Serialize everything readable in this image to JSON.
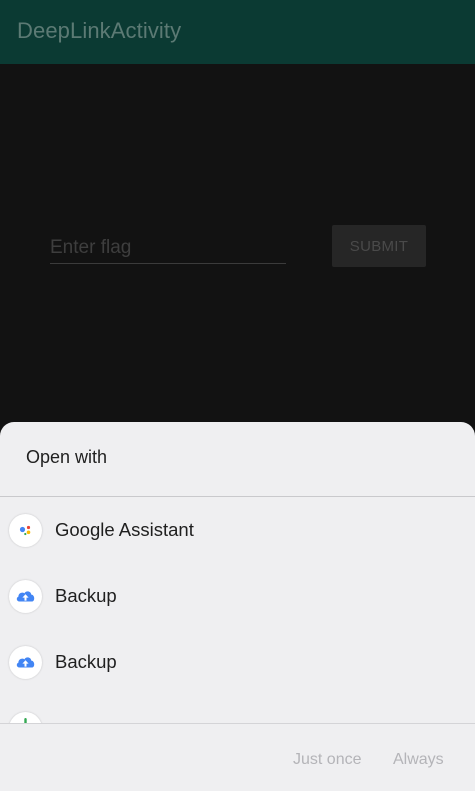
{
  "appbar": {
    "title": "DeepLinkActivity"
  },
  "form": {
    "flag_placeholder": "Enter flag",
    "submit_label": "SUBMIT"
  },
  "sheet": {
    "title": "Open with",
    "apps": [
      {
        "label": "Google Assistant",
        "icon": "google-assistant-icon"
      },
      {
        "label": "Backup",
        "icon": "cloud-upload-icon"
      },
      {
        "label": "Backup",
        "icon": "cloud-upload-icon"
      },
      {
        "label": "",
        "icon": "partial-app-icon"
      }
    ],
    "just_once_label": "Just once",
    "always_label": "Always"
  },
  "colors": {
    "appbar": "#0b3a33",
    "sheet_bg": "#efeff1",
    "backup_blue": "#4285f4",
    "disabled_text": "#b4b4b8"
  }
}
